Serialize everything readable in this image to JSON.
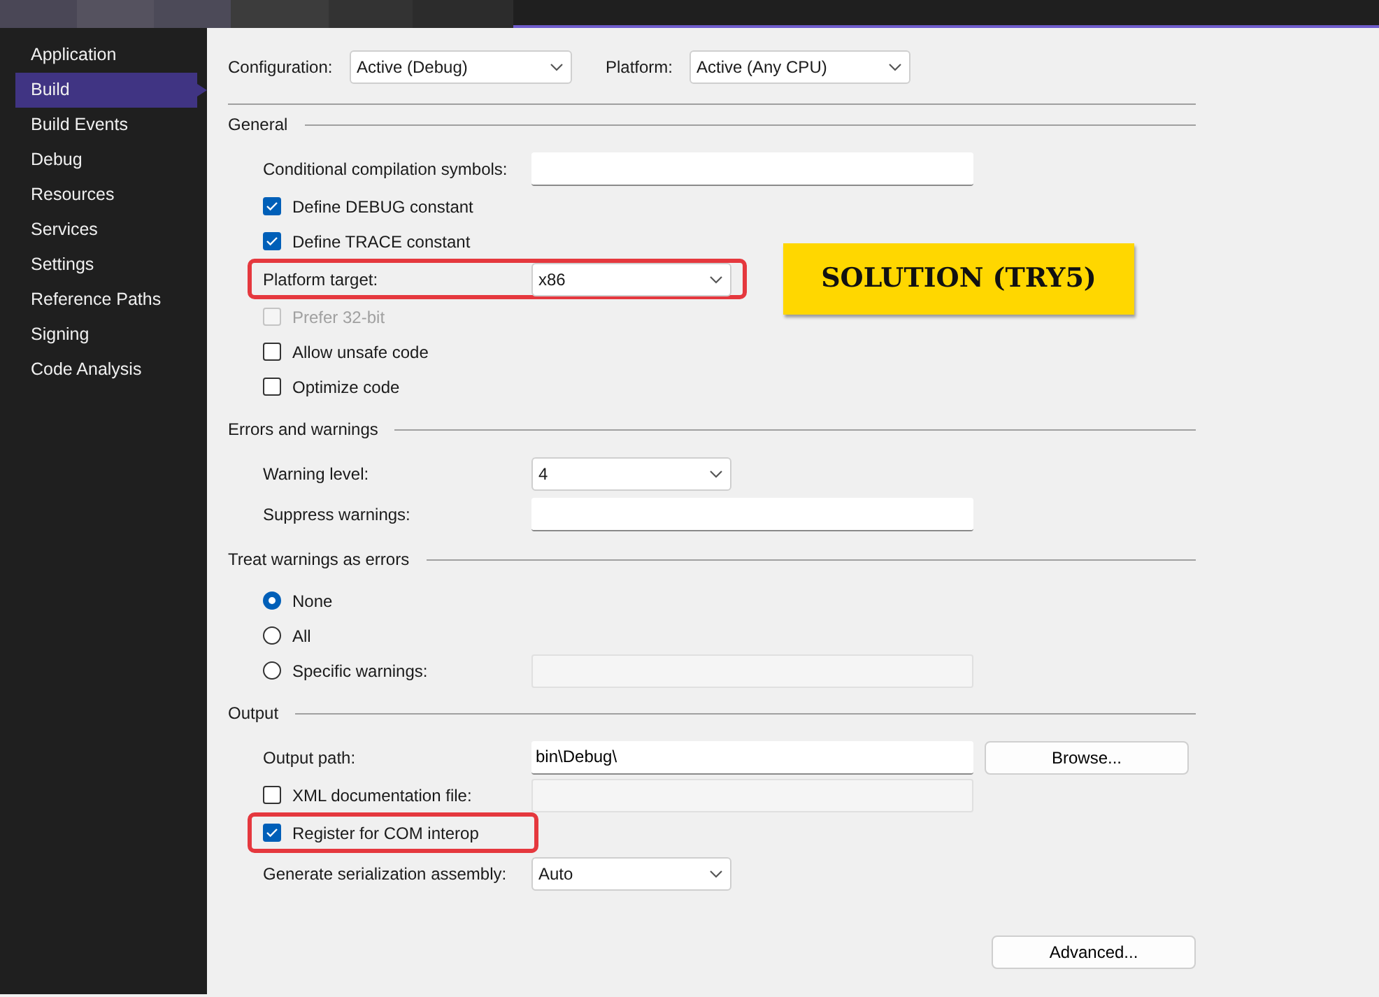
{
  "sidebar": {
    "items": [
      {
        "label": "Application",
        "selected": false
      },
      {
        "label": "Build",
        "selected": true
      },
      {
        "label": "Build Events",
        "selected": false
      },
      {
        "label": "Debug",
        "selected": false
      },
      {
        "label": "Resources",
        "selected": false
      },
      {
        "label": "Services",
        "selected": false
      },
      {
        "label": "Settings",
        "selected": false
      },
      {
        "label": "Reference Paths",
        "selected": false
      },
      {
        "label": "Signing",
        "selected": false
      },
      {
        "label": "Code Analysis",
        "selected": false
      }
    ]
  },
  "toolbar": {
    "configuration": {
      "label": "Configuration:",
      "value": "Active (Debug)"
    },
    "platform": {
      "label": "Platform:",
      "value": "Active (Any CPU)"
    }
  },
  "sections": [
    {
      "title": "General",
      "rows": [
        {
          "kind": "text",
          "label": "Conditional compilation symbols:",
          "disabled": false,
          "highlighted": false
        },
        {
          "kind": "checkbox",
          "label": "Define DEBUG constant",
          "checked": true,
          "disabled": false,
          "highlighted": false
        },
        {
          "kind": "checkbox",
          "label": "Define TRACE constant",
          "checked": true,
          "disabled": false,
          "highlighted": false
        },
        {
          "kind": "select",
          "label": "Platform target:",
          "value": "x86",
          "highlighted": true
        },
        {
          "kind": "checkbox",
          "label": "Prefer 32-bit",
          "checked": false,
          "disabled": true,
          "highlighted": false
        },
        {
          "kind": "checkbox",
          "label": "Allow unsafe code",
          "checked": false,
          "disabled": false,
          "highlighted": false
        },
        {
          "kind": "checkbox",
          "label": "Optimize code",
          "checked": false,
          "disabled": false,
          "highlighted": false
        }
      ]
    },
    {
      "title": "Errors and warnings",
      "rows": [
        {
          "kind": "select",
          "label": "Warning level:",
          "value": "4",
          "highlighted": false
        },
        {
          "kind": "text",
          "label": "Suppress warnings:",
          "disabled": false,
          "highlighted": false
        }
      ]
    },
    {
      "title": "Treat warnings as errors",
      "rows": [
        {
          "kind": "radio",
          "label": "None",
          "selected": true,
          "highlighted": false
        },
        {
          "kind": "radio",
          "label": "All",
          "selected": false,
          "highlighted": false
        },
        {
          "kind": "radio",
          "label": "Specific warnings:",
          "selected": false,
          "highlighted": false,
          "field": {
            "disabled": true
          }
        }
      ]
    },
    {
      "title": "Output",
      "rows": [
        {
          "kind": "text",
          "label": "Output path:",
          "value": "bin\\Debug\\",
          "disabled": false,
          "highlighted": false,
          "button": "Browse..."
        },
        {
          "kind": "checkbox",
          "label": "XML documentation file:",
          "checked": false,
          "disabled": false,
          "highlighted": false,
          "field": {
            "disabled": true
          }
        },
        {
          "kind": "checkbox",
          "label": "Register for COM interop",
          "checked": true,
          "disabled": false,
          "highlighted": true
        },
        {
          "kind": "select",
          "label": "Generate serialization assembly:",
          "value": "Auto",
          "highlighted": false
        }
      ]
    }
  ],
  "footer_button": "Advanced...",
  "annotation": {
    "text": "SOLUTION (TRY5)"
  }
}
